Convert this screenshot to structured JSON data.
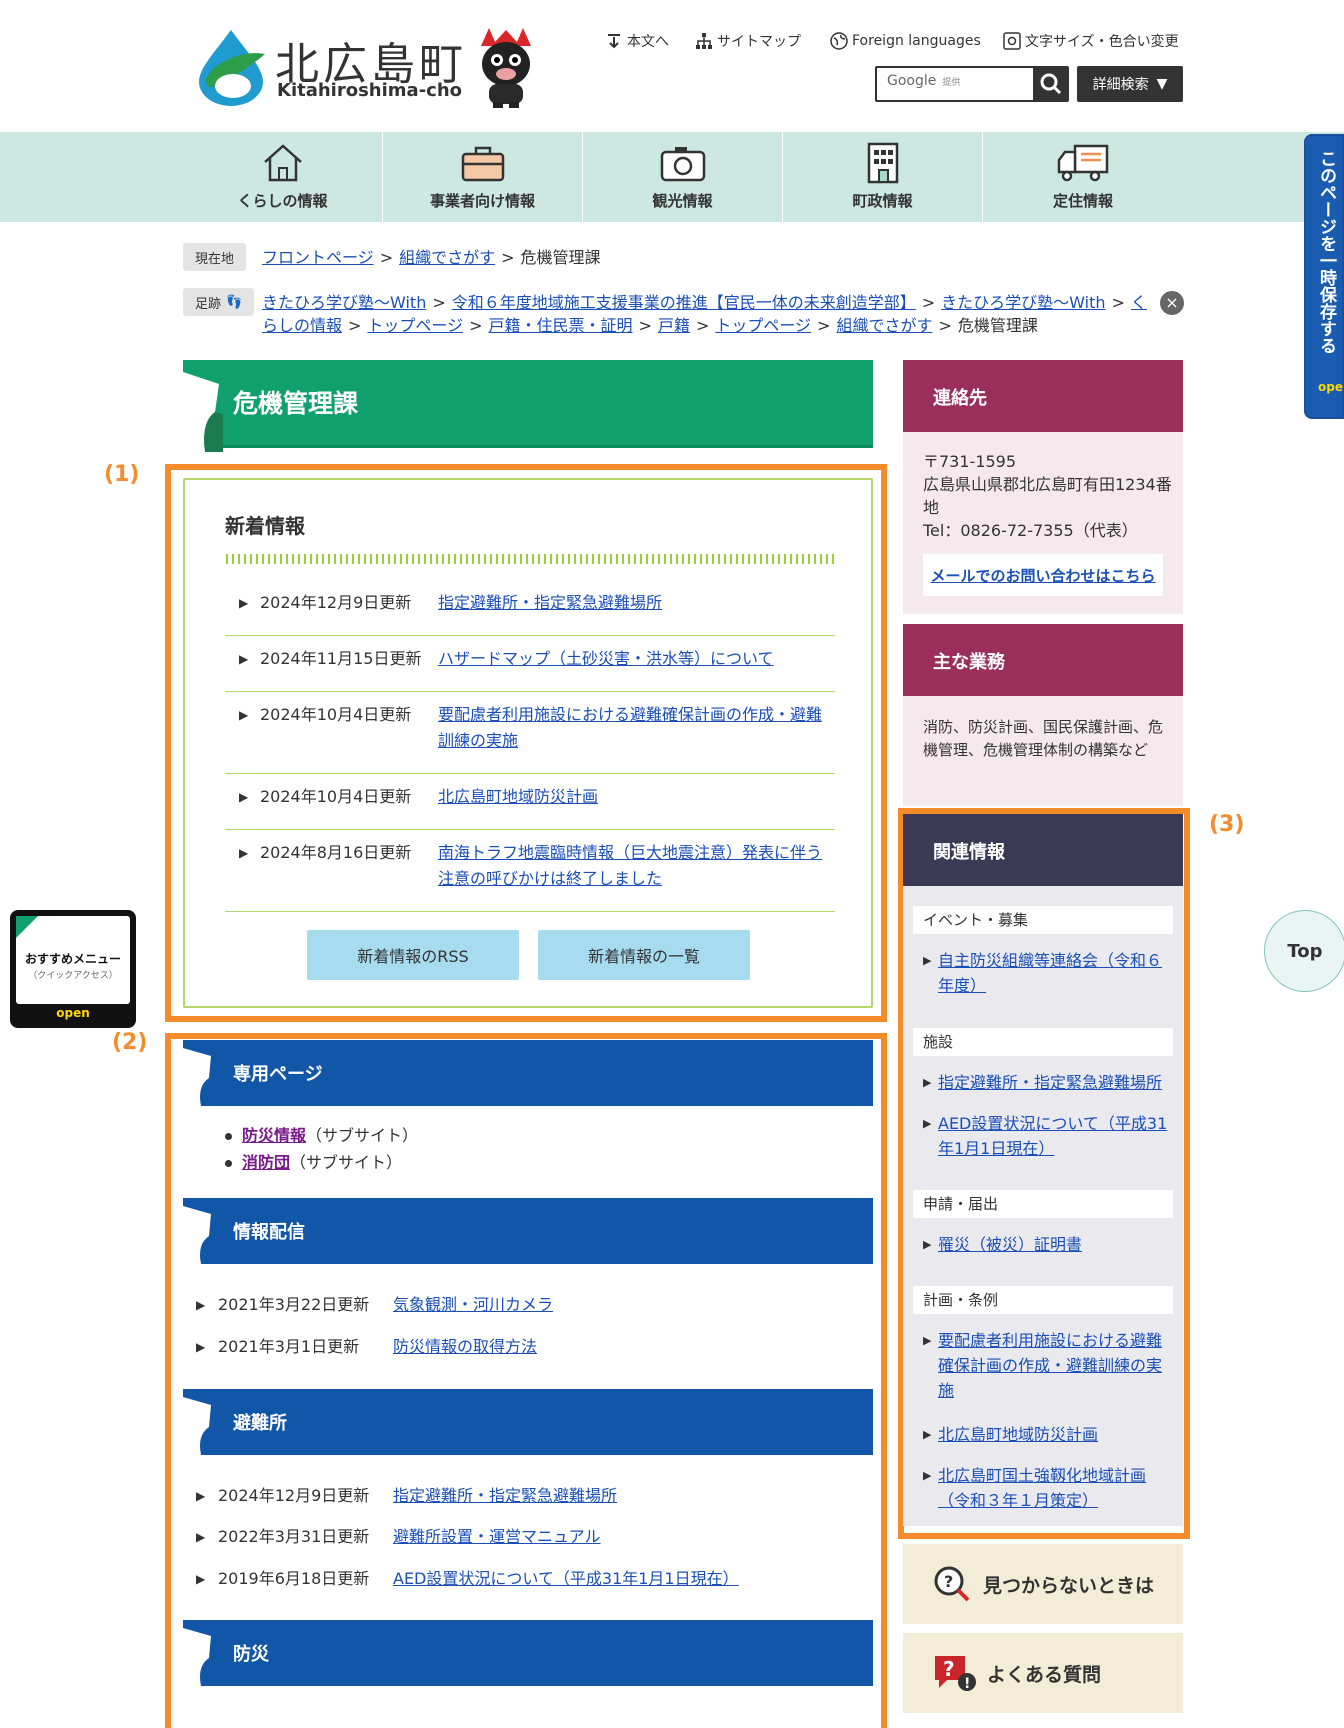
{
  "header": {
    "logo_title": "北広島町",
    "logo_sub": "Kitahiroshima-cho",
    "util": {
      "skip": "本文へ",
      "sitemap": "サイトマップ",
      "foreign": "Foreign languages",
      "textsize": "文字サイズ・色合い変更"
    },
    "search": {
      "google_label": "Google",
      "provided": "提供",
      "advanced": "詳細検索"
    }
  },
  "gnav": [
    {
      "label": "くらしの情報",
      "icon": "house-icon"
    },
    {
      "label": "事業者向け情報",
      "icon": "briefcase-icon"
    },
    {
      "label": "観光情報",
      "icon": "camera-icon"
    },
    {
      "label": "町政情報",
      "icon": "building-icon"
    },
    {
      "label": "定住情報",
      "icon": "truck-icon"
    }
  ],
  "side_tab": {
    "text": "このページを一時保存する",
    "open": "open"
  },
  "breadcrumb": {
    "current_label": "現在地",
    "current": [
      "フロントページ",
      "組織でさがす",
      "危機管理課"
    ],
    "history_label": "足跡",
    "history_line1": [
      "きたひろ学び塾～With",
      "令和６年度地域施工支援事業の推進【官民一体の未来創造学部】",
      "きたひろ学び塾～With",
      "く"
    ],
    "history_line2": [
      "らしの情報",
      "トップページ",
      "戸籍・住民票・証明",
      "戸籍",
      "トップページ",
      "組織でさがす",
      "危機管理課"
    ],
    "separator": ">"
  },
  "page_title": "危機管理課",
  "labels": {
    "one": "(1)",
    "two": "(2)",
    "three": "(3)"
  },
  "news": {
    "title": "新着情報",
    "items": [
      {
        "date": "2024年12月9日更新",
        "title": "指定避難所・指定緊急避難場所"
      },
      {
        "date": "2024年11月15日更新",
        "title": "ハザードマップ（土砂災害・洪水等）について"
      },
      {
        "date": "2024年10月4日更新",
        "title": "要配慮者利用施設における避難確保計画の作成・避難訓練の実施"
      },
      {
        "date": "2024年10月4日更新",
        "title": "北広島町地域防災計画"
      },
      {
        "date": "2024年8月16日更新",
        "title": "南海トラフ地震臨時情報（巨大地震注意）発表に伴う注意の呼びかけは終了しました"
      }
    ],
    "rss_button": "新着情報のRSS",
    "list_button": "新着情報の一覧"
  },
  "sections": {
    "dedicated": {
      "title": "専用ページ",
      "items": [
        {
          "link": "防災情報",
          "note": "（サブサイト）"
        },
        {
          "link": "消防団",
          "note": "（サブサイト）"
        }
      ]
    },
    "delivery": {
      "title": "情報配信",
      "items": [
        {
          "date": "2021年3月22日更新",
          "title": "気象観測・河川カメラ"
        },
        {
          "date": "2021年3月1日更新",
          "title": "防災情報の取得方法"
        }
      ]
    },
    "shelter": {
      "title": "避難所",
      "items": [
        {
          "date": "2024年12月9日更新",
          "title": "指定避難所・指定緊急避難場所"
        },
        {
          "date": "2022年3月31日更新",
          "title": "避難所設置・運営マニュアル"
        },
        {
          "date": "2019年6月18日更新",
          "title": "AED設置状況について（平成31年1月1日現在）"
        }
      ]
    },
    "disaster": {
      "title": "防災"
    }
  },
  "contact": {
    "title": "連絡先",
    "postal": "〒731-1595",
    "address": "広島県山県郡北広島町有田1234番地",
    "tel": "Tel：0826-72-7355（代表）",
    "mail_button": "メールでのお問い合わせはこちら"
  },
  "duties": {
    "title": "主な業務",
    "text": "消防、防災計画、国民保護計画、危機管理、危機管理体制の構築など"
  },
  "related": {
    "title": "関連情報",
    "categories": [
      {
        "name": "イベント・募集",
        "links": [
          "自主防災組織等連絡会（令和６年度）"
        ]
      },
      {
        "name": "施設",
        "links": [
          "指定避難所・指定緊急避難場所",
          "AED設置状況について（平成31年1月1日現在）"
        ]
      },
      {
        "name": "申請・届出",
        "links": [
          "罹災（被災）証明書"
        ]
      },
      {
        "name": "計画・条例",
        "links": [
          "要配慮者利用施設における避難確保計画の作成・避難訓練の実施",
          "北広島町地域防災計画",
          "北広島町国土強靱化地域計画（令和３年１月策定）"
        ]
      }
    ]
  },
  "help": {
    "not_found": "見つからないときは",
    "faq": "よくある質問"
  },
  "quick_menu": {
    "title": "おすすめメニュー",
    "sub": "（クイックアクセス）",
    "open": "open"
  },
  "top_button": "Top",
  "colors": {
    "green": "#0fa06e",
    "blue": "#1256a8",
    "maroon": "#9a2f5c",
    "navy": "#3a3a55",
    "orange": "#f68b2c",
    "mint": "#cde8e0"
  }
}
